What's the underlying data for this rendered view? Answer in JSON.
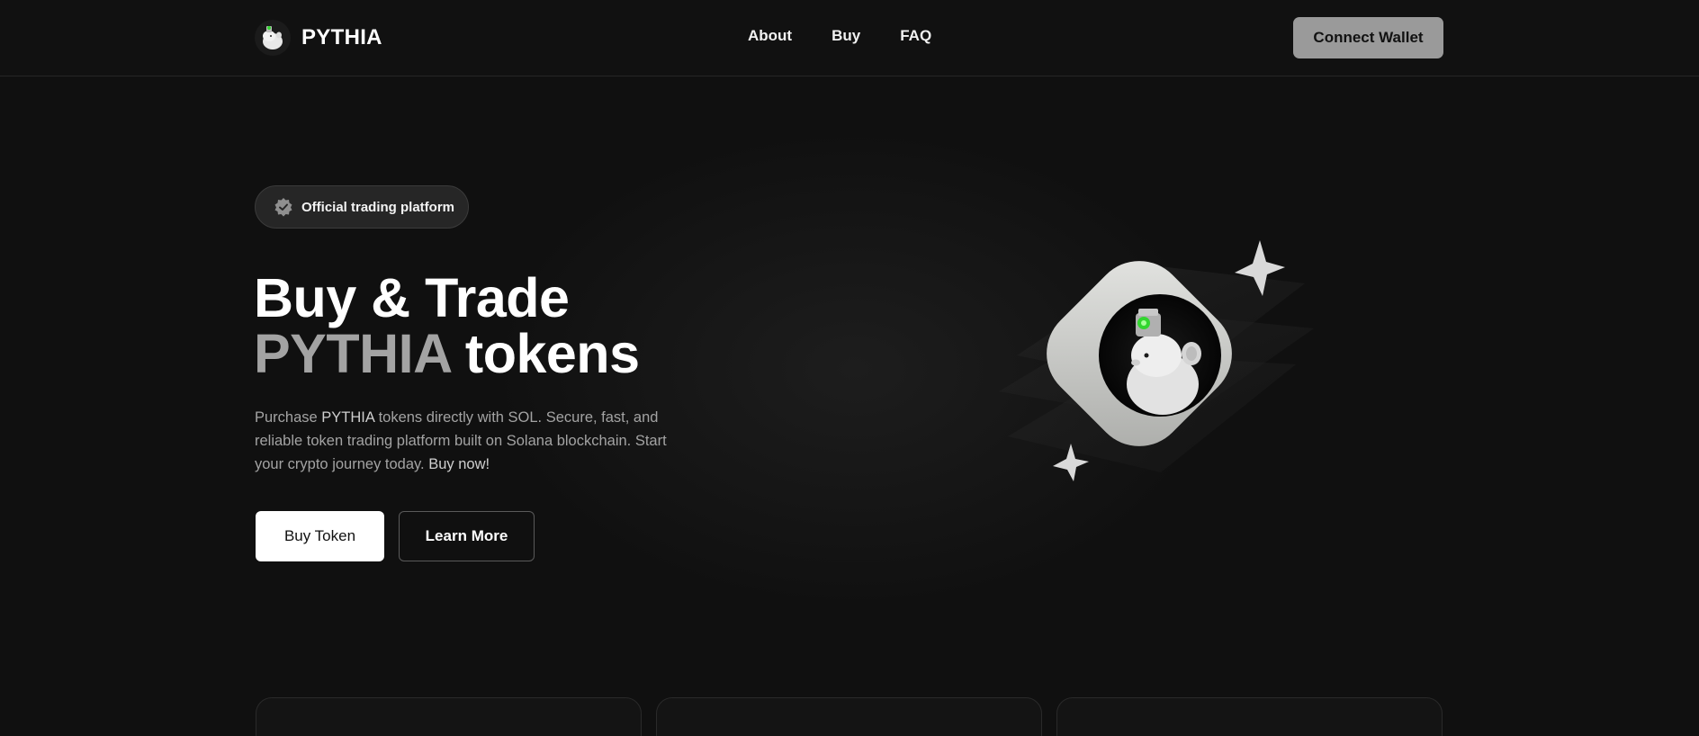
{
  "header": {
    "brand_name": "PYTHIA",
    "logo_icon": "pythia-logo-icon",
    "nav": [
      {
        "label": "About"
      },
      {
        "label": "Buy"
      },
      {
        "label": "FAQ"
      }
    ],
    "connect_label": "Connect Wallet"
  },
  "hero": {
    "badge_icon": "verified-badge-icon",
    "badge_text": "Official trading platform",
    "headline_line1": "Buy & Trade",
    "headline_highlight": "PYTHIA",
    "headline_rest": " tokens",
    "desc_part1": "Purchase ",
    "desc_highlight1": "PYTHIA",
    "desc_part2": " tokens directly with SOL. Secure, fast, and reliable token trading platform built on Solana blockchain. Start your crypto journey today. ",
    "desc_highlight2": "Buy now!",
    "buy_label": "Buy Token",
    "learn_label": "Learn More"
  },
  "colors": {
    "background": "#101010",
    "accent_green": "#32d62f",
    "muted_text": "#a3a3a3",
    "button_gray": "#9a9a9a"
  }
}
